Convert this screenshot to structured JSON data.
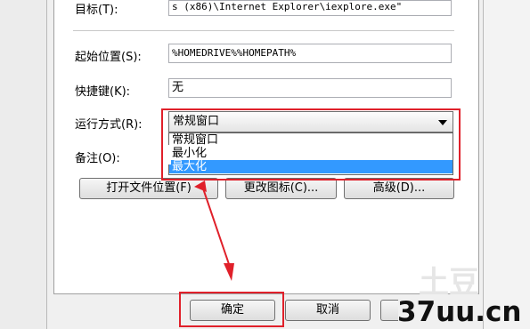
{
  "window": {
    "bg": "#f0f0f0",
    "accent": "#3399ff",
    "highlight_color": "#e0202a"
  },
  "fields": {
    "target_label": "目标(T):",
    "target_value": "s (x86)\\Internet Explorer\\iexplore.exe\"",
    "start_in_label": "起始位置(S):",
    "start_in_value": "%HOMEDRIVE%%HOMEPATH%",
    "shortcut_label": "快捷键(K):",
    "shortcut_value": "无",
    "run_label": "运行方式(R):",
    "run_value": "常规窗口",
    "comment_label": "备注(O):"
  },
  "dropdown": {
    "options": [
      "常规窗口",
      "最小化",
      "最大化"
    ],
    "selected_index": 2
  },
  "buttons": {
    "open_location": "打开文件位置(F)",
    "change_icon": "更改图标(C)...",
    "advanced": "高级(D)...",
    "ok": "确定",
    "cancel": "取消"
  },
  "watermark": {
    "text": "37uu.cn",
    "shadow_text": "土豆"
  }
}
